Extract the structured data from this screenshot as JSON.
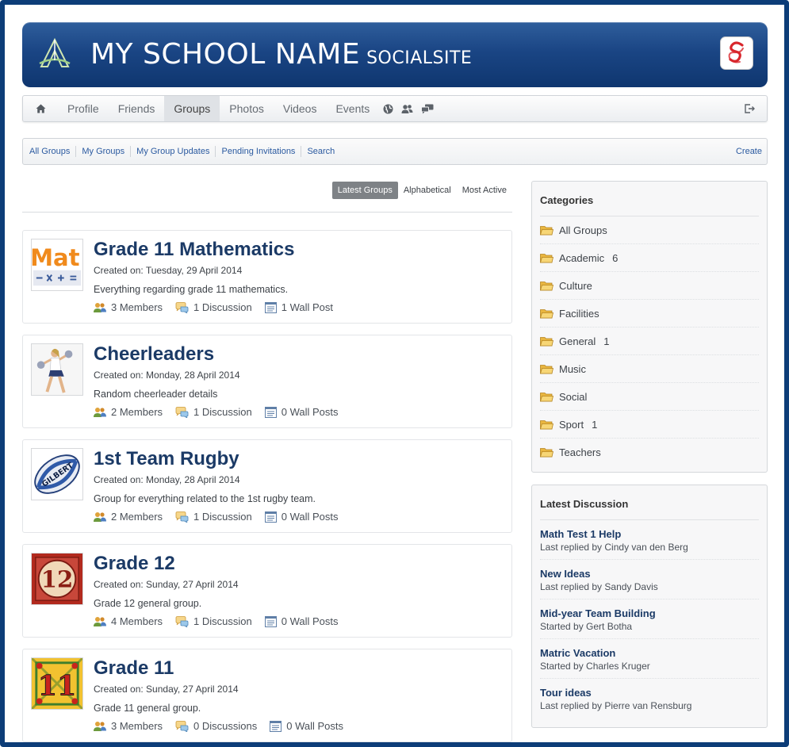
{
  "banner": {
    "title": "MY SCHOOL NAME",
    "subtitle": "SOCIALSITE",
    "colors": {
      "banner": "#1a4584",
      "frame": "#0d3d78"
    }
  },
  "topnav": {
    "items": [
      {
        "label": "Profile"
      },
      {
        "label": "Friends"
      },
      {
        "label": "Groups",
        "active": true
      },
      {
        "label": "Photos"
      },
      {
        "label": "Videos"
      },
      {
        "label": "Events"
      }
    ],
    "icons": [
      "home-icon",
      "globe-icon",
      "people-icon",
      "chat-icon",
      "logout-icon"
    ]
  },
  "subnav": {
    "links": [
      "All Groups",
      "My Groups",
      "My Group Updates",
      "Pending Invitations",
      "Search"
    ],
    "create": "Create"
  },
  "sort": {
    "tabs": [
      "Latest Groups",
      "Alphabetical",
      "Most Active"
    ],
    "active": "Latest Groups"
  },
  "groups": [
    {
      "title": "Grade 11 Mathematics",
      "created": "Created on: Tuesday, 29 April 2014",
      "description": "Everything regarding grade 11 mathematics.",
      "members": "3 Members",
      "discussions": "1 Discussion",
      "wall": "1 Wall Post"
    },
    {
      "title": "Cheerleaders",
      "created": "Created on: Monday, 28 April 2014",
      "description": "Random cheerleader details",
      "members": "2 Members",
      "discussions": "1 Discussion",
      "wall": "0 Wall Posts"
    },
    {
      "title": "1st Team Rugby",
      "created": "Created on: Monday, 28 April 2014",
      "description": "Group for everything related to the 1st rugby team.",
      "members": "2 Members",
      "discussions": "1 Discussion",
      "wall": "0 Wall Posts"
    },
    {
      "title": "Grade 12",
      "created": "Created on: Sunday, 27 April 2014",
      "description": "Grade 12 general group.",
      "members": "4 Members",
      "discussions": "1 Discussion",
      "wall": "0 Wall Posts"
    },
    {
      "title": "Grade 11",
      "created": "Created on: Sunday, 27 April 2014",
      "description": "Grade 11 general group.",
      "members": "3 Members",
      "discussions": "0 Discussions",
      "wall": "0 Wall Posts"
    }
  ],
  "thumbnails": {
    "math_text": "Mat",
    "rugby_text": "GILBERT",
    "grade12_text": "12",
    "grade11_text": "11"
  },
  "categories": {
    "heading": "Categories",
    "items": [
      {
        "label": "All Groups",
        "count": ""
      },
      {
        "label": "Academic",
        "count": "6"
      },
      {
        "label": "Culture",
        "count": ""
      },
      {
        "label": "Facilities",
        "count": ""
      },
      {
        "label": "General",
        "count": "1"
      },
      {
        "label": "Music",
        "count": ""
      },
      {
        "label": "Social",
        "count": ""
      },
      {
        "label": "Sport",
        "count": "1"
      },
      {
        "label": "Teachers",
        "count": ""
      }
    ]
  },
  "latest_discussion": {
    "heading": "Latest Discussion",
    "items": [
      {
        "title": "Math Test 1 Help",
        "prefix": "Last replied by",
        "user": "Cindy van den Berg"
      },
      {
        "title": "New Ideas",
        "prefix": "Last replied by",
        "user": "Sandy Davis"
      },
      {
        "title": "Mid-year Team Building",
        "prefix": "Started by",
        "user": "Gert Botha"
      },
      {
        "title": "Matric Vacation",
        "prefix": "Started by",
        "user": "Charles Kruger"
      },
      {
        "title": "Tour ideas",
        "prefix": "Last replied by",
        "user": "Pierre van Rensburg"
      }
    ]
  }
}
